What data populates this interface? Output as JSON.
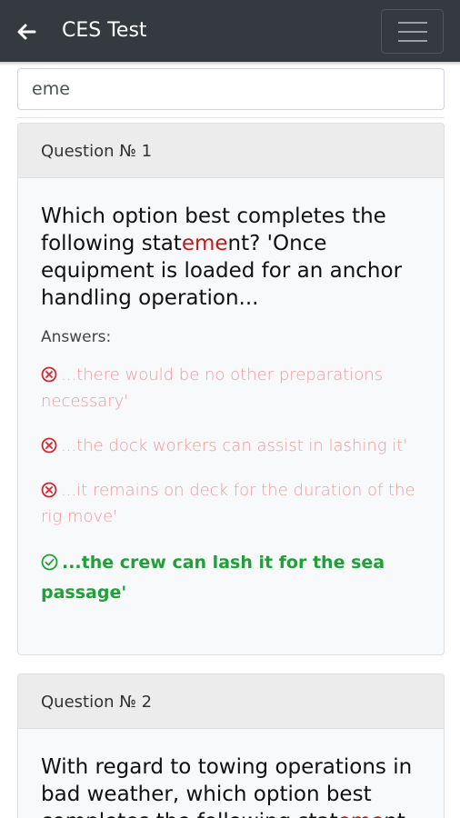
{
  "header": {
    "title": "CES Test",
    "back_icon": "arrow-left-icon",
    "menu_icon": "hamburger-menu-icon"
  },
  "search": {
    "value": "eme"
  },
  "questions": [
    {
      "header": "Question № 1",
      "text_parts": [
        "Which option best completes the following stat",
        "eme",
        "nt? 'Once equipment is loaded for an anchor handling operation..."
      ],
      "answers_label": "Answers:",
      "answers": [
        {
          "text": "...there would be no other preparations necessary'",
          "status": "wrong",
          "icon": "x-circle-icon"
        },
        {
          "text": "...the dock workers can assist in lashing it'",
          "status": "wrong",
          "icon": "x-circle-icon"
        },
        {
          "text": "...it remains on deck for the duration of the rig move'",
          "status": "wrong",
          "icon": "x-circle-icon"
        },
        {
          "text": "...the crew can lash it for the sea passage'",
          "status": "correct",
          "icon": "check-circle-icon"
        }
      ]
    },
    {
      "header": "Question № 2",
      "text_parts": [
        "With regard to towing operations in bad weather, which option best completes the following stat",
        "eme",
        "nt"
      ]
    }
  ],
  "colors": {
    "navbar": "#343a40",
    "highlight": "#b91c1c",
    "wrong_answer": "#f09a9a",
    "correct_answer": "#21a038"
  }
}
